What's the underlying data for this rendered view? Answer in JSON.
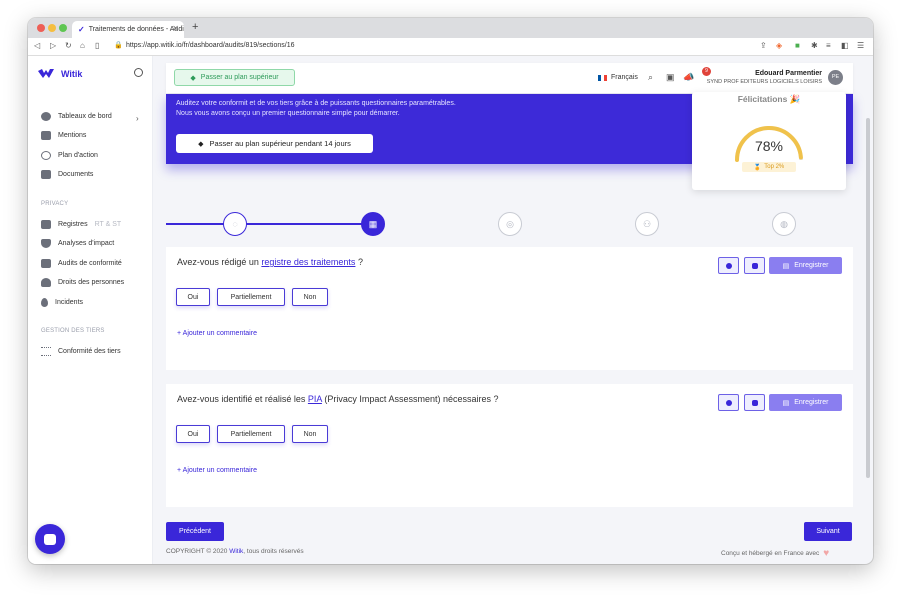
{
  "browser": {
    "tab_title": "Traitements de données - Audi",
    "url": "https://app.witik.io/fr/dashboard/audits/819/sections/16"
  },
  "sidebar": {
    "app_name": "Witik",
    "items": [
      {
        "label": "Tableaux de bord"
      },
      {
        "label": "Mentions"
      },
      {
        "label": "Plan d'action"
      },
      {
        "label": "Documents"
      }
    ],
    "privacy_heading": "PRIVACY",
    "privacy_items": [
      {
        "label": "Registres",
        "sub": "RT & ST"
      },
      {
        "label": "Analyses d'impact"
      },
      {
        "label": "Audits de conformité"
      },
      {
        "label": "Droits des personnes"
      },
      {
        "label": "Incidents"
      }
    ],
    "tiers_heading": "GESTION DES TIERS",
    "tiers_items": [
      {
        "label": "Conformité des tiers"
      }
    ]
  },
  "topbar": {
    "upgrade_label": "Passer au plan supérieur",
    "language": "Français",
    "notifications_count": "9",
    "user_name": "Edouard Parmentier",
    "user_company": "SYND PROF EDITEURS LOGICIELS LOISIRS",
    "user_initials": "PE"
  },
  "banner": {
    "line1": "Auditez votre conformit et de vos tiers grâce à de puissants questionnaires paramétrables.",
    "line2": "Nous vous avons conçu un premier questionnaire simple pour démarrer.",
    "button": "Passer au plan supérieur pendant 14 jours"
  },
  "score_card": {
    "title": "Félicitations 🎉",
    "percent": "78%",
    "percent_value": 0.78,
    "top": "Top 2%"
  },
  "stepper": {
    "current_step": 2,
    "total_steps": 5
  },
  "questions": [
    {
      "prefix": "Avez-vous rédigé un ",
      "link": "registre des traitements",
      "suffix": " ?",
      "answers": [
        "Oui",
        "Partiellement",
        "Non"
      ],
      "comment": "+ Ajouter un commentaire",
      "save": "Enregistrer"
    },
    {
      "prefix": "Avez-vous identifié et réalisé les ",
      "link": "PIA",
      "suffix": " (Privacy Impact Assessment) nécessaires ?",
      "answers": [
        "Oui",
        "Partiellement",
        "Non"
      ],
      "comment": "+ Ajouter un commentaire",
      "save": "Enregistrer"
    }
  ],
  "footer": {
    "prev": "Précédent",
    "next": "Suivant",
    "copyright_prefix": "COPYRIGHT © 2020 ",
    "copyright_brand": "Witik",
    "copyright_suffix": ", tous droits réservés",
    "made_in": "Conçu et hébergé en France avec"
  },
  "colors": {
    "primary": "#3a27d9",
    "success": "#2e9b5a",
    "gauge": "#f0c24b"
  }
}
